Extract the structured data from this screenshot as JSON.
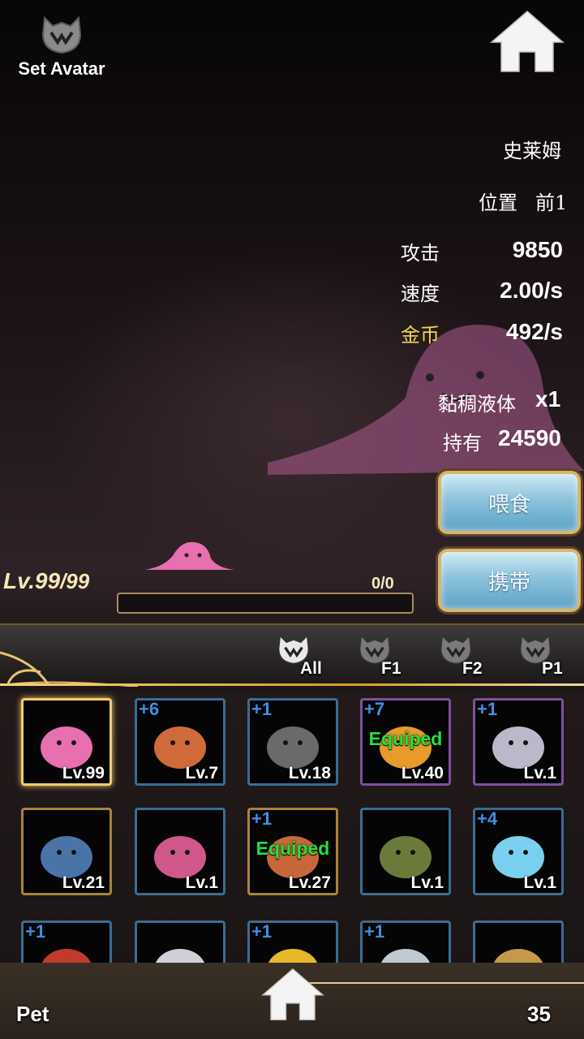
{
  "header": {
    "set_avatar_label": "Set Avatar"
  },
  "pet_info": {
    "name": "史莱姆",
    "position_label": "位置",
    "position_value": "前1",
    "attack_label": "攻击",
    "attack_value": "9850",
    "speed_label": "速度",
    "speed_value": "2.00/s",
    "gold_label": "金币",
    "gold_value": "492/s",
    "item_name": "黏稠液体",
    "item_qty": "x1",
    "owned_label": "持有",
    "owned_value": "24590"
  },
  "actions": {
    "feed_label": "喂食",
    "carry_label": "携带"
  },
  "level": {
    "current": "Lv.99",
    "max": "/99",
    "xp_text": "0/0",
    "xp_fraction": 0
  },
  "tabs": [
    {
      "label": "All"
    },
    {
      "label": "F1"
    },
    {
      "label": "F2"
    },
    {
      "label": "P1"
    }
  ],
  "pets": [
    {
      "plus": "",
      "level": "Lv.99",
      "status": "",
      "icon": "pink-slime-icon",
      "frame": "selected"
    },
    {
      "plus": "+6",
      "level": "Lv.7",
      "status": "",
      "icon": "mushroom-pet-icon",
      "frame": "blue"
    },
    {
      "plus": "+1",
      "level": "Lv.18",
      "status": "",
      "icon": "robot-egg-icon",
      "frame": "blue"
    },
    {
      "plus": "+7",
      "level": "Lv.40",
      "status": "Equiped",
      "icon": "orange-bird-icon",
      "frame": "purple"
    },
    {
      "plus": "+1",
      "level": "Lv.1",
      "status": "",
      "icon": "hooded-girl-icon",
      "frame": "purple"
    },
    {
      "plus": "",
      "level": "Lv.21",
      "status": "",
      "icon": "ice-knight-icon",
      "frame": "gold"
    },
    {
      "plus": "",
      "level": "Lv.1",
      "status": "",
      "icon": "pink-monster-icon",
      "frame": "blue"
    },
    {
      "plus": "+1",
      "level": "Lv.27",
      "status": "Equiped",
      "icon": "dragon-rider-icon",
      "frame": "gold"
    },
    {
      "plus": "",
      "level": "Lv.1",
      "status": "",
      "icon": "green-plant-icon",
      "frame": "blue"
    },
    {
      "plus": "+4",
      "level": "Lv.1",
      "status": "",
      "icon": "blue-slime-icon",
      "frame": "blue"
    },
    {
      "plus": "+1",
      "level": "",
      "status": "",
      "icon": "red-bug-icon",
      "frame": "blue"
    },
    {
      "plus": "",
      "level": "",
      "status": "",
      "icon": "white-beast-icon",
      "frame": "blue"
    },
    {
      "plus": "+1",
      "level": "",
      "status": "",
      "icon": "helmet-pet-icon",
      "frame": "blue"
    },
    {
      "plus": "+1",
      "level": "",
      "status": "",
      "icon": "small-robot-icon",
      "frame": "blue"
    },
    {
      "plus": "",
      "level": "",
      "status": "",
      "icon": "goggles-icon",
      "frame": "blue"
    }
  ],
  "footer": {
    "section_label": "Pet",
    "count": "35"
  },
  "colors": {
    "gold_label": "#f2d648",
    "equiped": "#27e03a",
    "plus": "#3f8fe6"
  }
}
